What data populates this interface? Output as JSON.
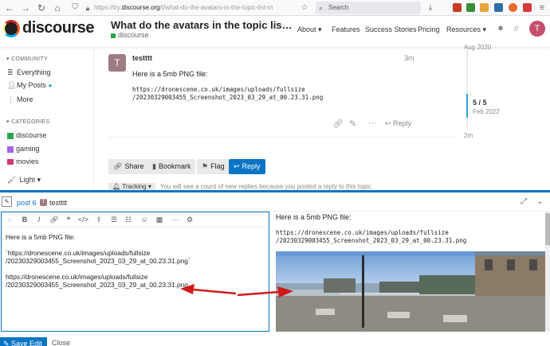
{
  "browser": {
    "url_host": "https://try.",
    "url_domain": "discourse.org",
    "url_path": "/t/what-do-the-avatars-in-the-topic-list-m",
    "search_placeholder": "Search"
  },
  "header": {
    "logo": "discourse",
    "topic_title": "What do the avatars in the topic lis…",
    "category": "discourse",
    "nav": [
      "About",
      "Features",
      "Success Stories",
      "Pricing",
      "Resources"
    ],
    "user_initial": "T"
  },
  "sidebar": {
    "community_header": "COMMUNITY",
    "community_items": [
      "Everything",
      "My Posts",
      "More"
    ],
    "categories_header": "CATEGORIES",
    "categories": [
      {
        "label": "discourse",
        "color": "#25aa4a"
      },
      {
        "label": "gaming",
        "color": "#a461ef"
      },
      {
        "label": "movies",
        "color": "#d3386b"
      }
    ],
    "theme_label": "Light"
  },
  "post": {
    "avatar_initial": "T",
    "username": "testttt",
    "time": "3m",
    "body_line": "Here is a 5mb PNG file:",
    "url_text": "https://dronescene.co.uk/images/uploads/fullsize\n/20230329003455_Screenshot_2023_03_29_at_00.23.31.png",
    "reply_label": "Reply"
  },
  "timeline": {
    "start_date": "Aug 2020",
    "position": "5 / 5",
    "current_date": "Feb 2022",
    "ago": "2m"
  },
  "footer_buttons": {
    "share": "Share",
    "bookmark": "Bookmark",
    "flag": "Flag",
    "reply": "Reply"
  },
  "tracking": {
    "button": "Tracking",
    "message": "You will see a count of new replies because you posted a reply to this topic."
  },
  "composer": {
    "post_link": "post 6",
    "reply_user_initial": "T",
    "reply_user": "testttt",
    "editor_text": "Here is a 5mb PNG file:\n\n`https://dronescene.co.uk/images/uploads/fullsize\n/20230329003455_Screenshot_2023_03_29_at_00.23.31.png`\n\nhttps://dronescene.co.uk/images/uploads/fullsize\n/20230329003455_Screenshot_2023_03_29_at_00.23.31.png",
    "preview_line": "Here is a 5mb PNG file:",
    "preview_url": "https://dronescene.co.uk/images/uploads/fullsize\n/20230329003455_Screenshot_2023_03_29_at_00.23.31.png",
    "save_label": "Save Edit",
    "close_label": "Close"
  },
  "colors": {
    "primary": "#0a74c5",
    "annotation_arrow": "#d01a1a"
  }
}
